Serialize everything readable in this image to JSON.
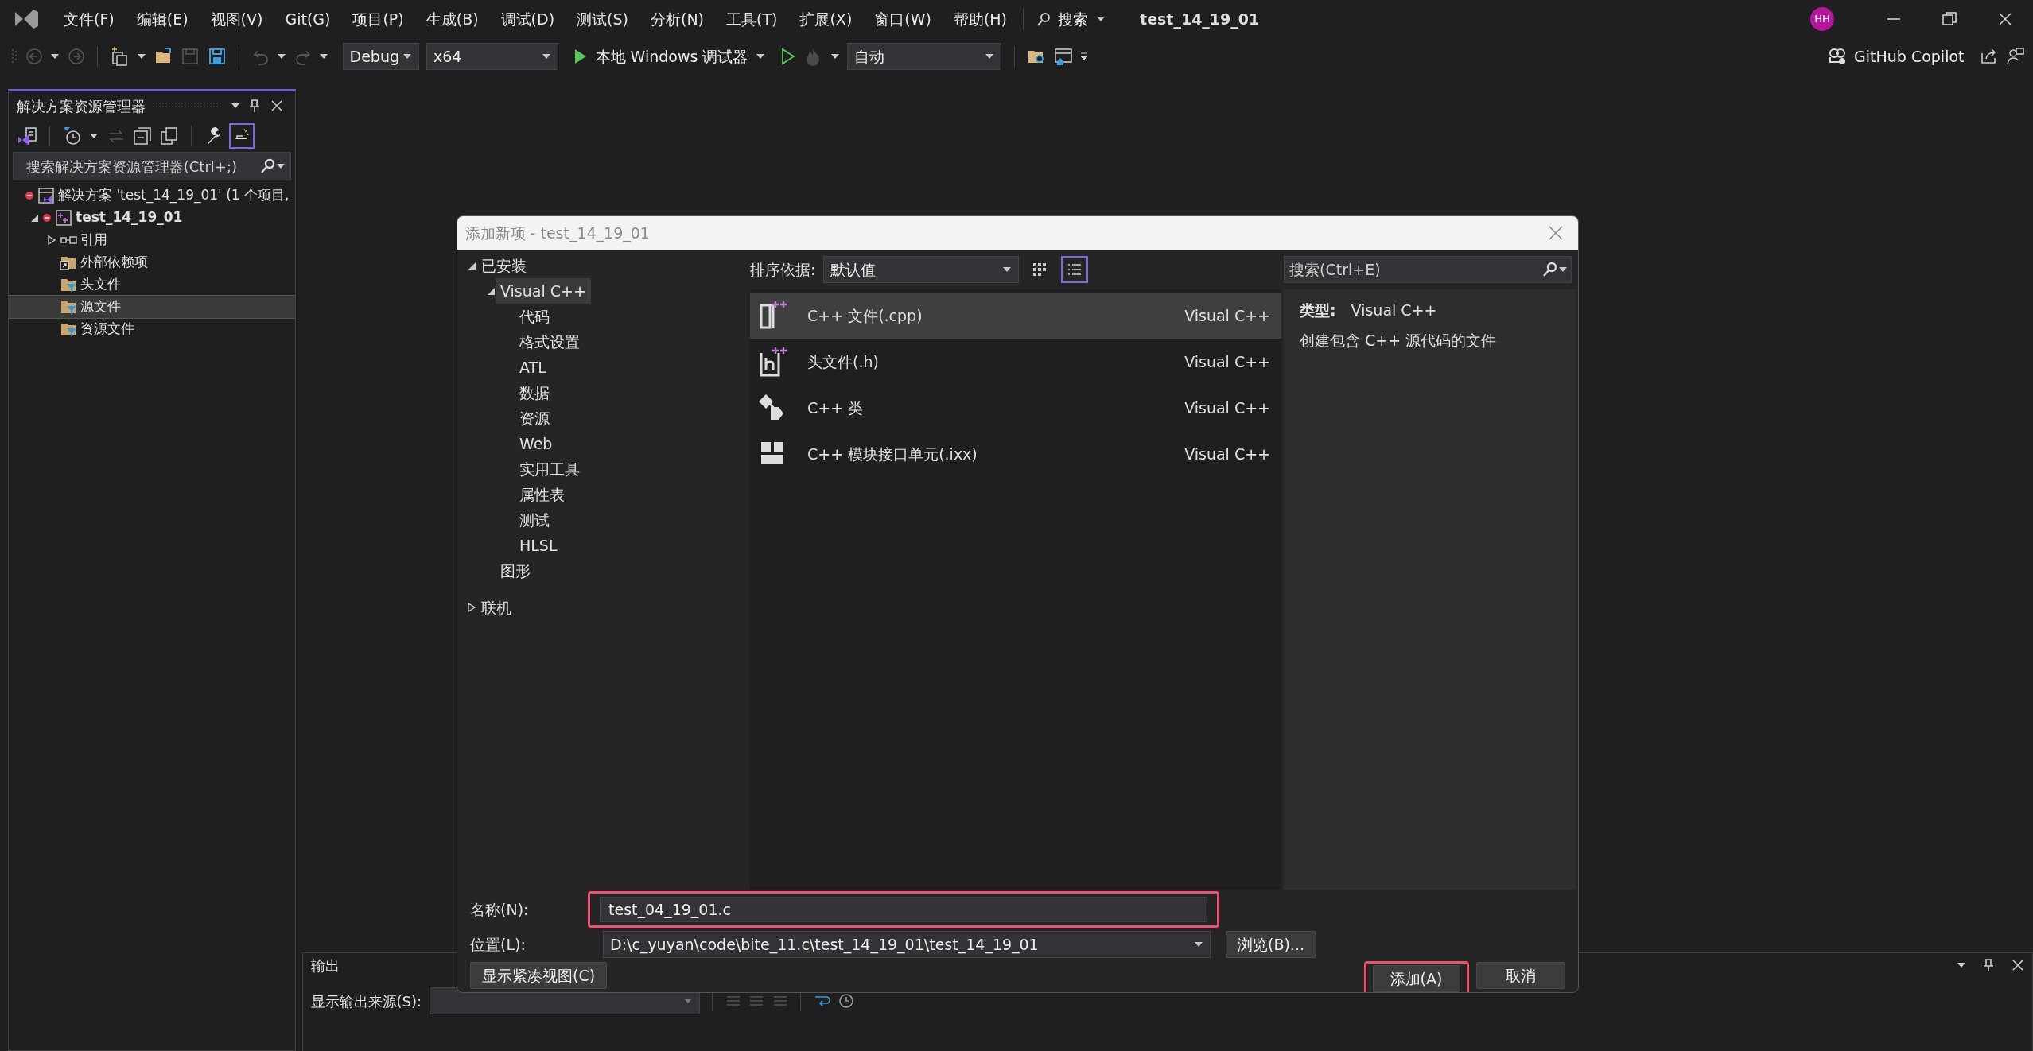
{
  "title_bar": {
    "menu": [
      "文件(F)",
      "编辑(E)",
      "视图(V)",
      "Git(G)",
      "项目(P)",
      "生成(B)",
      "调试(D)",
      "测试(S)",
      "分析(N)",
      "工具(T)",
      "扩展(X)",
      "窗口(W)",
      "帮助(H)"
    ],
    "search": "搜索",
    "project_title": "test_14_19_01",
    "avatar": "HH"
  },
  "toolbar": {
    "configuration": "Debug",
    "platform": "x64",
    "run": "本地 Windows 调试器",
    "mode": "自动",
    "copilot": "GitHub Copilot"
  },
  "solution_explorer": {
    "title": "解决方案资源管理器",
    "search_placeholder": "搜索解决方案资源管理器(Ctrl+;)",
    "tree": [
      {
        "label": "解决方案 'test_14_19_01' (1 个项目,",
        "kind": "solution",
        "selected": false,
        "children": [
          {
            "label": "test_14_19_01",
            "kind": "project",
            "expanded": true,
            "selected": false,
            "children": [
              {
                "label": "引用",
                "kind": "references",
                "expanded": false,
                "selected": false
              },
              {
                "label": "外部依赖项",
                "kind": "dependencies",
                "selected": false
              },
              {
                "label": "头文件",
                "kind": "filter",
                "selected": false
              },
              {
                "label": "源文件",
                "kind": "filter",
                "selected": true
              },
              {
                "label": "资源文件",
                "kind": "filter",
                "selected": false
              }
            ]
          }
        ]
      }
    ]
  },
  "output_panel": {
    "title": "输出",
    "source_label": "显示输出来源(S):"
  },
  "dialog": {
    "title": "添加新项 - test_14_19_01",
    "categories": [
      {
        "label": "已安装",
        "expanded": true,
        "selected": false,
        "children": [
          {
            "label": "Visual C++",
            "expanded": true,
            "selected": true,
            "children": [
              {
                "label": "代码",
                "selected": false
              },
              {
                "label": "格式设置",
                "selected": false
              },
              {
                "label": "ATL",
                "selected": false
              },
              {
                "label": "数据",
                "selected": false
              },
              {
                "label": "资源",
                "selected": false
              },
              {
                "label": "Web",
                "selected": false
              },
              {
                "label": "实用工具",
                "selected": false
              },
              {
                "label": "属性表",
                "selected": false
              },
              {
                "label": "测试",
                "selected": false
              },
              {
                "label": "HLSL",
                "selected": false
              }
            ]
          },
          {
            "label": "图形",
            "selected": false
          }
        ]
      },
      {
        "label": "联机",
        "expanded": false,
        "selected": false
      }
    ],
    "sort_label": "排序依据:",
    "sort_value": "默认值",
    "view_modes": [
      {
        "kind": "grid",
        "selected": false
      },
      {
        "kind": "list",
        "selected": true
      }
    ],
    "templates": [
      {
        "name": "C++ 文件(.cpp)",
        "type": "Visual C++",
        "kind": "cpp",
        "selected": true
      },
      {
        "name": "头文件(.h)",
        "type": "Visual C++",
        "kind": "header",
        "selected": false
      },
      {
        "name": "C++ 类",
        "type": "Visual C++",
        "kind": "class",
        "selected": false
      },
      {
        "name": "C++ 模块接口单元(.ixx)",
        "type": "Visual C++",
        "kind": "module",
        "selected": false
      }
    ],
    "search_placeholder": "搜索(Ctrl+E)",
    "details": {
      "type_label": "类型:",
      "type_value": "Visual C++",
      "description": "创建包含 C++ 源代码的文件"
    },
    "name_field": {
      "label": "名称(N):",
      "value": "test_04_19_01.c",
      "highlighted": true
    },
    "location_field": {
      "label": "位置(L):",
      "value": "D:\\c_yuyan\\code\\bite_11.c\\test_14_19_01\\test_14_19_01"
    },
    "browse_button": "浏览(B)...",
    "compact_view_button": "显示紧凑视图(C)",
    "add_button": {
      "label": "添加(A)",
      "highlighted": true
    },
    "cancel_button": "取消"
  }
}
